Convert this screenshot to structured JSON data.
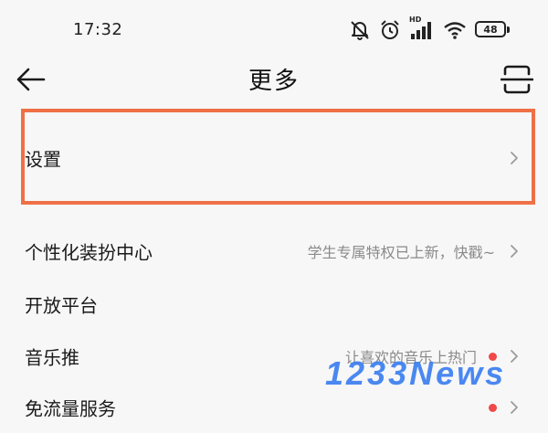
{
  "status_bar": {
    "time": "17:32",
    "network_label": "HD",
    "battery_level": "48",
    "icons": [
      "mute-icon",
      "alarm-icon",
      "signal-icon",
      "wifi-icon",
      "battery-icon"
    ]
  },
  "header": {
    "title": "更多",
    "back_icon": "arrow-left-icon",
    "scan_icon": "scan-icon"
  },
  "menu": {
    "items": [
      {
        "label": "设置",
        "hint": "",
        "dot": false,
        "highlighted": true
      },
      {
        "label": "个性化装扮中心",
        "hint": "学生专属特权已上新，快戳~",
        "dot": false
      },
      {
        "label": "开放平台",
        "hint": "",
        "dot": false
      },
      {
        "label": "音乐推",
        "hint": "让喜欢的音乐上热门",
        "dot": true
      },
      {
        "label": "免流量服务",
        "hint": "",
        "dot": true
      }
    ]
  },
  "colors": {
    "highlight_border": "#ef7046",
    "badge_dot": "#f04848",
    "background": "#f7f7f7",
    "watermark": "#3c7ff0"
  },
  "watermark": {
    "text": "1233News"
  }
}
